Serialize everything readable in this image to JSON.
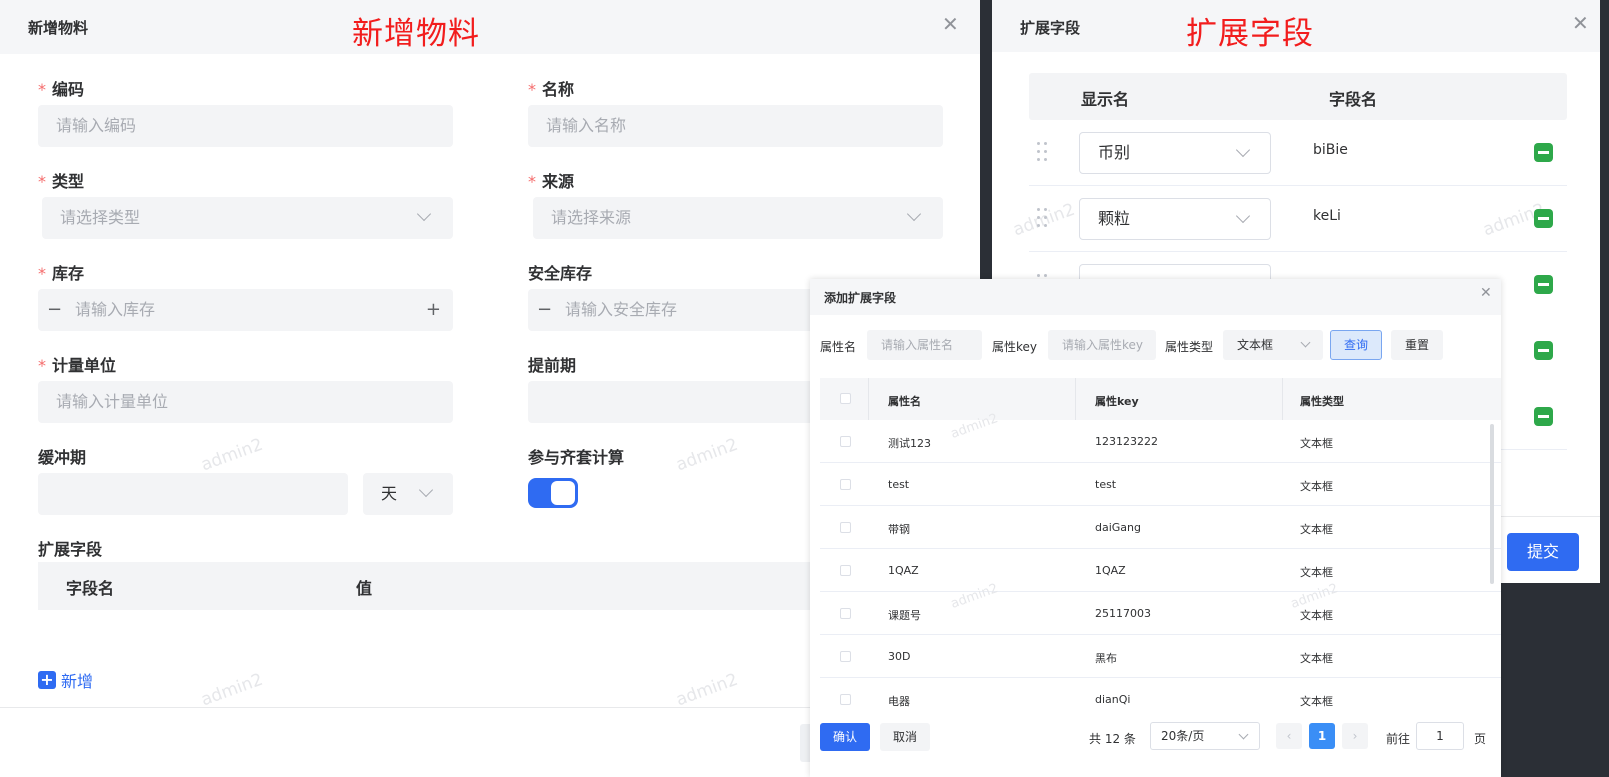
{
  "add_material": {
    "title": "新增物料",
    "annotation": "新增物料",
    "fields": {
      "code": {
        "label": "编码",
        "placeholder": "请输入编码"
      },
      "name": {
        "label": "名称",
        "placeholder": "请输入名称"
      },
      "type": {
        "label": "类型",
        "placeholder": "请选择类型"
      },
      "source": {
        "label": "来源",
        "placeholder": "请选择来源"
      },
      "stock": {
        "label": "库存",
        "placeholder": "请输入库存"
      },
      "safety_stock": {
        "label": "安全库存",
        "placeholder": "请输入安全库存"
      },
      "unit": {
        "label": "计量单位",
        "placeholder": "请输入计量单位"
      },
      "lead_time": {
        "label": "提前期",
        "placeholder": ""
      },
      "buffer": {
        "label": "缓冲期",
        "value": "",
        "unit": "天"
      },
      "kit_calc": {
        "label": "参与齐套计算",
        "on": true
      }
    },
    "required_mark": "*",
    "ext_section": {
      "label": "扩展字段",
      "col_field": "字段名",
      "col_value": "值"
    },
    "add_label": "新增",
    "watermark": "admin2"
  },
  "ext_fields": {
    "title": "扩展字段",
    "annotation": "扩展字段",
    "col_display": "显示名",
    "col_field": "字段名",
    "rows": [
      {
        "display": "币别",
        "field": "biBie"
      },
      {
        "display": "颗粒",
        "field": "keLi"
      }
    ],
    "submit_label": "提交"
  },
  "add_ext_dialog": {
    "title": "添加扩展字段",
    "search": {
      "attr_name_label": "属性名",
      "attr_name_placeholder": "请输入属性名",
      "attr_key_label": "属性key",
      "attr_key_placeholder": "请输入属性key",
      "attr_type_label": "属性类型",
      "attr_type_value": "文本框",
      "query_label": "查询",
      "reset_label": "重置"
    },
    "columns": [
      "属性名",
      "属性key",
      "属性类型"
    ],
    "rows": [
      [
        "测试123",
        "123123222",
        "文本框"
      ],
      [
        "test",
        "test",
        "文本框"
      ],
      [
        "带钢",
        "daiGang",
        "文本框"
      ],
      [
        "1QAZ",
        "1QAZ",
        "文本框"
      ],
      [
        "课题号",
        "25117003",
        "文本框"
      ],
      [
        "30D",
        "黑布",
        "文本框"
      ],
      [
        "电器",
        "dianQi",
        "文本框"
      ]
    ],
    "confirm_label": "确认",
    "cancel_label": "取消",
    "pagination": {
      "total": "共 12 条",
      "page_size": "20条/页",
      "prev": "‹",
      "current": "1",
      "next": "›",
      "goto_label": "前往",
      "goto_value": "1",
      "page_label": "页"
    }
  },
  "colors": {
    "primary": "#2f6bf2",
    "danger_annotation": "#f21d1d",
    "success": "#2ea84a"
  }
}
